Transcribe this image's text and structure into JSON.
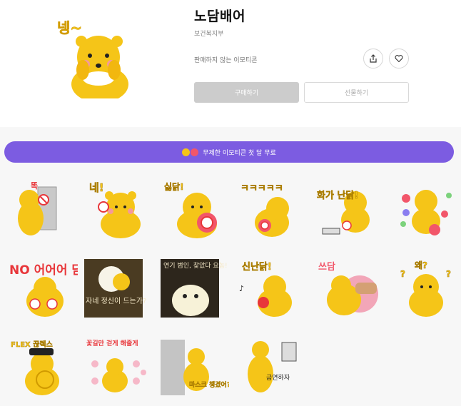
{
  "product": {
    "title": "노담배어",
    "author": "보건복지부",
    "status": "판매하지 않는 이모티콘",
    "hero_caption": "넹~"
  },
  "actions": {
    "share_icon": "share-icon",
    "like_icon": "heart-icon",
    "buy_label": "구매하기",
    "gift_label": "선물하기"
  },
  "promo": {
    "label": "무제한 이모티콘 첫 달 무료"
  },
  "stickers": [
    {
      "caption": "똑"
    },
    {
      "caption": "네!"
    },
    {
      "caption": "싫닭!"
    },
    {
      "caption": "ㅋㅋㅋㅋㅋ"
    },
    {
      "caption": "화가 난닭!"
    },
    {
      "caption": ""
    },
    {
      "caption": "NO 어어어 담"
    },
    {
      "caption": "자네 정신이 드는가?"
    },
    {
      "caption": "연기 범인, 찾았다 요놈!"
    },
    {
      "caption": "신난닭!"
    },
    {
      "caption": "쓰담"
    },
    {
      "caption": "왜?"
    },
    {
      "caption": "FLEX 끊렉스"
    },
    {
      "caption": "꽃길만 걷게 해줄게"
    },
    {
      "caption": "마스크 챙겼어?"
    },
    {
      "caption": "금연하자"
    }
  ],
  "colors": {
    "bear_yellow": "#f5c518",
    "promo_purple": "#7c5ce1",
    "buy_disabled": "#cccccc",
    "nosmoke_red": "#e8363a"
  }
}
